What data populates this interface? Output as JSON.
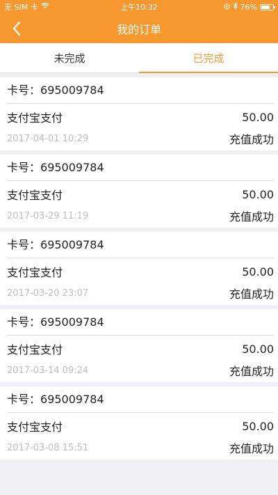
{
  "status_bar": {
    "carrier": "无 SIM 卡",
    "time": "上午10:32",
    "battery": "76%",
    "battery_level": 0.76
  },
  "nav": {
    "title": "我的订单"
  },
  "tabs": [
    {
      "label": "未完成",
      "active": false
    },
    {
      "label": "已完成",
      "active": true
    }
  ],
  "orders": [
    {
      "card_prefix": "卡号：",
      "card_no": "695009784",
      "method": "支付宝支付",
      "amount": "50.00",
      "date": "2017-04-01 10:29",
      "status": "充值成功"
    },
    {
      "card_prefix": "卡号：",
      "card_no": "695009784",
      "method": "支付宝支付",
      "amount": "50.00",
      "date": "2017-03-29 11:19",
      "status": "充值成功"
    },
    {
      "card_prefix": "卡号：",
      "card_no": "695009784",
      "method": "支付宝支付",
      "amount": "50.00",
      "date": "2017-03-20 23:07",
      "status": "充值成功"
    },
    {
      "card_prefix": "卡号：",
      "card_no": "695009784",
      "method": "支付宝支付",
      "amount": "50.00",
      "date": "2017-03-14 09:24",
      "status": "充值成功"
    },
    {
      "card_prefix": "卡号：",
      "card_no": "695009784",
      "method": "支付宝支付",
      "amount": "50.00",
      "date": "2017-03-08 15:51",
      "status": "充值成功"
    }
  ],
  "colors": {
    "accent": "#f7982f",
    "background": "#efeff4"
  }
}
